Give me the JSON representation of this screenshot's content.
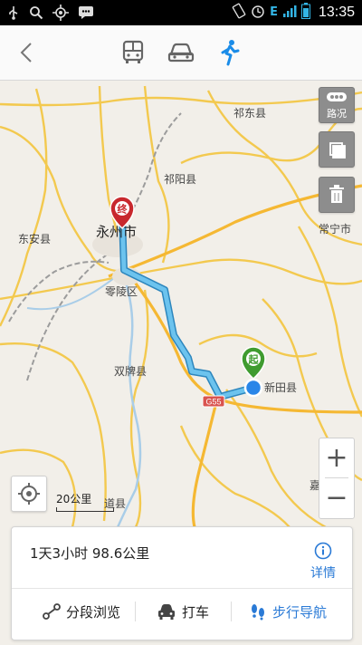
{
  "status_bar": {
    "time": "13:35",
    "network": "E",
    "left_icons": [
      "usb-icon",
      "search-icon",
      "gps-icon",
      "chat-icon"
    ],
    "right_icons": [
      "rotate-icon",
      "alarm-icon",
      "signal-icon",
      "battery-icon"
    ]
  },
  "top_bar": {
    "modes": [
      "bus-icon",
      "car-icon",
      "walk-icon"
    ],
    "active_mode": "walk",
    "accent": "#1a8ce8"
  },
  "map": {
    "places": {
      "qidong": "祁东县",
      "qiyang": "祁阳县",
      "changning": "常宁市",
      "dongan": "东安县",
      "yongzhou": "永州市",
      "lingling": "零陵区",
      "shuangpai": "双牌县",
      "xintian": "新田县",
      "daoxian": "道县",
      "jia": "嘉"
    },
    "highway": "G55",
    "start_marker": "起",
    "end_marker": "终",
    "route_color": "#5cb8e8",
    "start_color": "#3f9b2f",
    "end_color": "#c8282d"
  },
  "controls": {
    "traffic_label": "路况",
    "zoom_in": "+",
    "zoom_out": "−",
    "scale_label": "20公里"
  },
  "route_panel": {
    "summary": "1天3小时  98.6公里",
    "detail_label": "详情",
    "actions": {
      "segments": "分段浏览",
      "taxi": "打车",
      "navigate": "步行导航"
    },
    "link_color": "#2a7ad6"
  }
}
